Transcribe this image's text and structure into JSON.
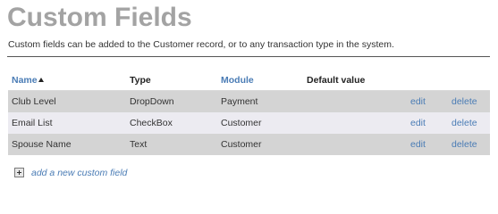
{
  "page": {
    "title": "Custom Fields",
    "intro": "Custom fields can be added to the Customer record, or to any transaction type in the system."
  },
  "table": {
    "columns": {
      "name": "Name",
      "type": "Type",
      "module": "Module",
      "default_value": "Default value"
    },
    "sort": {
      "column": "name",
      "direction": "ascending"
    },
    "rows": [
      {
        "name": "Club Level",
        "type": "DropDown",
        "module": "Payment",
        "default_value": "",
        "edit": "edit",
        "delete": "delete"
      },
      {
        "name": "Email List",
        "type": "CheckBox",
        "module": "Customer",
        "default_value": "",
        "edit": "edit",
        "delete": "delete"
      },
      {
        "name": "Spouse Name",
        "type": "Text",
        "module": "Customer",
        "default_value": "",
        "edit": "edit",
        "delete": "delete"
      }
    ]
  },
  "add_link": {
    "label": "add a new custom field",
    "icon": "plus-icon"
  },
  "colors": {
    "title": "#a3a3a3",
    "link": "#4a7cb5",
    "row_bg": "#d4d4d4",
    "row_alt_bg": "#ecebf1"
  }
}
